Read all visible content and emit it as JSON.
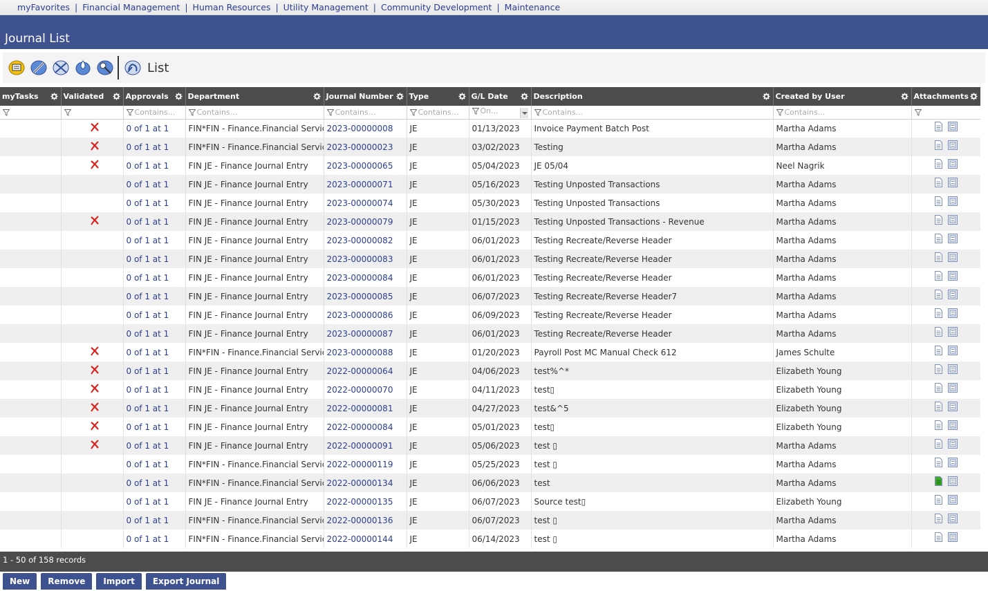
{
  "nav": [
    "myFavorites",
    "Financial Management",
    "Human Resources",
    "Utility Management",
    "Community Development",
    "Maintenance"
  ],
  "page_title": "Journal List",
  "toolbar": {
    "icons": [
      "summary-icon",
      "edit-icon",
      "post-icon",
      "drop-icon",
      "tools-icon",
      "list-icon"
    ],
    "list_label": "List"
  },
  "columns": [
    "myTasks",
    "Validated",
    "Approvals",
    "Department",
    "Journal Number",
    "Type",
    "G/L Date",
    "Description",
    "Created by User",
    "Attachments"
  ],
  "filters": [
    "",
    "",
    "Contains...",
    "Contains...",
    "Contains...",
    "Contains...",
    "On...",
    "Contains...",
    "Contains...",
    ""
  ],
  "rows": [
    {
      "validated_x": true,
      "approvals": "0 of 1 at 1",
      "department": "FIN*FIN - Finance.Financial Services",
      "journal": "2023-00000008",
      "type": "JE",
      "date": "01/13/2023",
      "description": "Invoice Payment Batch Post",
      "user": "Martha Adams",
      "green": false
    },
    {
      "validated_x": true,
      "approvals": "0 of 1 at 1",
      "department": "FIN*FIN - Finance.Financial Services",
      "journal": "2023-00000023",
      "type": "JE",
      "date": "03/02/2023",
      "description": "Testing",
      "user": "Martha Adams",
      "green": false
    },
    {
      "validated_x": true,
      "approvals": "0 of 1 at 1",
      "department": "FIN JE - Finance Journal Entry",
      "journal": "2023-00000065",
      "type": "JE",
      "date": "05/04/2023",
      "description": "JE 05/04",
      "user": "Neel Nagrik",
      "green": false
    },
    {
      "validated_x": false,
      "approvals": "0 of 1 at 1",
      "department": "FIN JE - Finance Journal Entry",
      "journal": "2023-00000071",
      "type": "JE",
      "date": "05/16/2023",
      "description": "Testing Unposted Transactions",
      "user": "Martha Adams",
      "green": false
    },
    {
      "validated_x": false,
      "approvals": "0 of 1 at 1",
      "department": "FIN JE - Finance Journal Entry",
      "journal": "2023-00000074",
      "type": "JE",
      "date": "05/30/2023",
      "description": "Testing Unposted Transactions",
      "user": "Martha Adams",
      "green": false
    },
    {
      "validated_x": true,
      "approvals": "0 of 1 at 1",
      "department": "FIN JE - Finance Journal Entry",
      "journal": "2023-00000079",
      "type": "JE",
      "date": "01/15/2023",
      "description": "Testing Unposted Transactions - Revenue",
      "user": "Martha Adams",
      "green": false
    },
    {
      "validated_x": false,
      "approvals": "0 of 1 at 1",
      "department": "FIN JE - Finance Journal Entry",
      "journal": "2023-00000082",
      "type": "JE",
      "date": "06/01/2023",
      "description": "Testing Recreate/Reverse Header",
      "user": "Martha Adams",
      "green": false
    },
    {
      "validated_x": false,
      "approvals": "0 of 1 at 1",
      "department": "FIN JE - Finance Journal Entry",
      "journal": "2023-00000083",
      "type": "JE",
      "date": "06/01/2023",
      "description": "Testing Recreate/Reverse Header",
      "user": "Martha Adams",
      "green": false
    },
    {
      "validated_x": false,
      "approvals": "0 of 1 at 1",
      "department": "FIN JE - Finance Journal Entry",
      "journal": "2023-00000084",
      "type": "JE",
      "date": "06/01/2023",
      "description": "Testing Recreate/Reverse Header",
      "user": "Martha Adams",
      "green": false
    },
    {
      "validated_x": false,
      "approvals": "0 of 1 at 1",
      "department": "FIN JE - Finance Journal Entry",
      "journal": "2023-00000085",
      "type": "JE",
      "date": "06/07/2023",
      "description": "Testing Recreate/Reverse Header7",
      "user": "Martha Adams",
      "green": false
    },
    {
      "validated_x": false,
      "approvals": "0 of 1 at 1",
      "department": "FIN JE - Finance Journal Entry",
      "journal": "2023-00000086",
      "type": "JE",
      "date": "06/09/2023",
      "description": "Testing Recreate/Reverse Header",
      "user": "Martha Adams",
      "green": false
    },
    {
      "validated_x": false,
      "approvals": "0 of 1 at 1",
      "department": "FIN JE - Finance Journal Entry",
      "journal": "2023-00000087",
      "type": "JE",
      "date": "06/01/2023",
      "description": "Testing Recreate/Reverse Header",
      "user": "Martha Adams",
      "green": false
    },
    {
      "validated_x": true,
      "approvals": "0 of 1 at 1",
      "department": "FIN*FIN - Finance.Financial Services",
      "journal": "2023-00000088",
      "type": "JE",
      "date": "01/20/2023",
      "description": "Payroll Post MC Manual Check 612",
      "user": "James Schulte",
      "green": false
    },
    {
      "validated_x": true,
      "approvals": "0 of 1 at 1",
      "department": "FIN JE - Finance Journal Entry",
      "journal": "2022-00000064",
      "type": "JE",
      "date": "04/06/2023",
      "description": "test%^*",
      "user": "Elizabeth Young",
      "green": false
    },
    {
      "validated_x": true,
      "approvals": "0 of 1 at 1",
      "department": "FIN JE - Finance Journal Entry",
      "journal": "2022-00000070",
      "type": "JE",
      "date": "04/11/2023",
      "description": "test▯",
      "user": "Elizabeth Young",
      "green": false
    },
    {
      "validated_x": true,
      "approvals": "0 of 1 at 1",
      "department": "FIN JE - Finance Journal Entry",
      "journal": "2022-00000081",
      "type": "JE",
      "date": "04/27/2023",
      "description": "test&^5",
      "user": "Elizabeth Young",
      "green": false
    },
    {
      "validated_x": true,
      "approvals": "0 of 1 at 1",
      "department": "FIN JE - Finance Journal Entry",
      "journal": "2022-00000084",
      "type": "JE",
      "date": "05/01/2023",
      "description": "test▯",
      "user": "Elizabeth Young",
      "green": false
    },
    {
      "validated_x": true,
      "approvals": "0 of 1 at 1",
      "department": "FIN JE - Finance Journal Entry",
      "journal": "2022-00000091",
      "type": "JE",
      "date": "05/06/2023",
      "description": "test ▯",
      "user": "Martha Adams",
      "green": false
    },
    {
      "validated_x": false,
      "approvals": "0 of 1 at 1",
      "department": "FIN*FIN - Finance.Financial Services",
      "journal": "2022-00000119",
      "type": "JE",
      "date": "05/25/2023",
      "description": "test ▯",
      "user": "Martha Adams",
      "green": false
    },
    {
      "validated_x": false,
      "approvals": "0 of 1 at 1",
      "department": "FIN*FIN - Finance.Financial Services",
      "journal": "2022-00000134",
      "type": "JE",
      "date": "06/06/2023",
      "description": "test",
      "user": "Martha Adams",
      "green": true
    },
    {
      "validated_x": false,
      "approvals": "0 of 1 at 1",
      "department": "FIN JE - Finance Journal Entry",
      "journal": "2022-00000135",
      "type": "JE",
      "date": "06/07/2023",
      "description": "Source test▯",
      "user": "Elizabeth Young",
      "green": false
    },
    {
      "validated_x": false,
      "approvals": "0 of 1 at 1",
      "department": "FIN*FIN - Finance.Financial Services",
      "journal": "2022-00000136",
      "type": "JE",
      "date": "06/07/2023",
      "description": "test ▯",
      "user": "Martha Adams",
      "green": false
    },
    {
      "validated_x": false,
      "approvals": "0 of 1 at 1",
      "department": "FIN*FIN - Finance.Financial Services",
      "journal": "2022-00000144",
      "type": "JE",
      "date": "06/14/2023",
      "description": "test ▯",
      "user": "Martha Adams",
      "green": false
    }
  ],
  "pager": "1 - 50 of 158 records",
  "buttons": {
    "new": "New",
    "remove": "Remove",
    "import": "Import",
    "export": "Export Journal"
  },
  "colors": {
    "nav_link": "#2b3f8f",
    "title_bar": "#3f5290",
    "grid_header": "#4c4c4c",
    "x_mark": "#d9211c",
    "attachment_green": "#3cab2c"
  }
}
